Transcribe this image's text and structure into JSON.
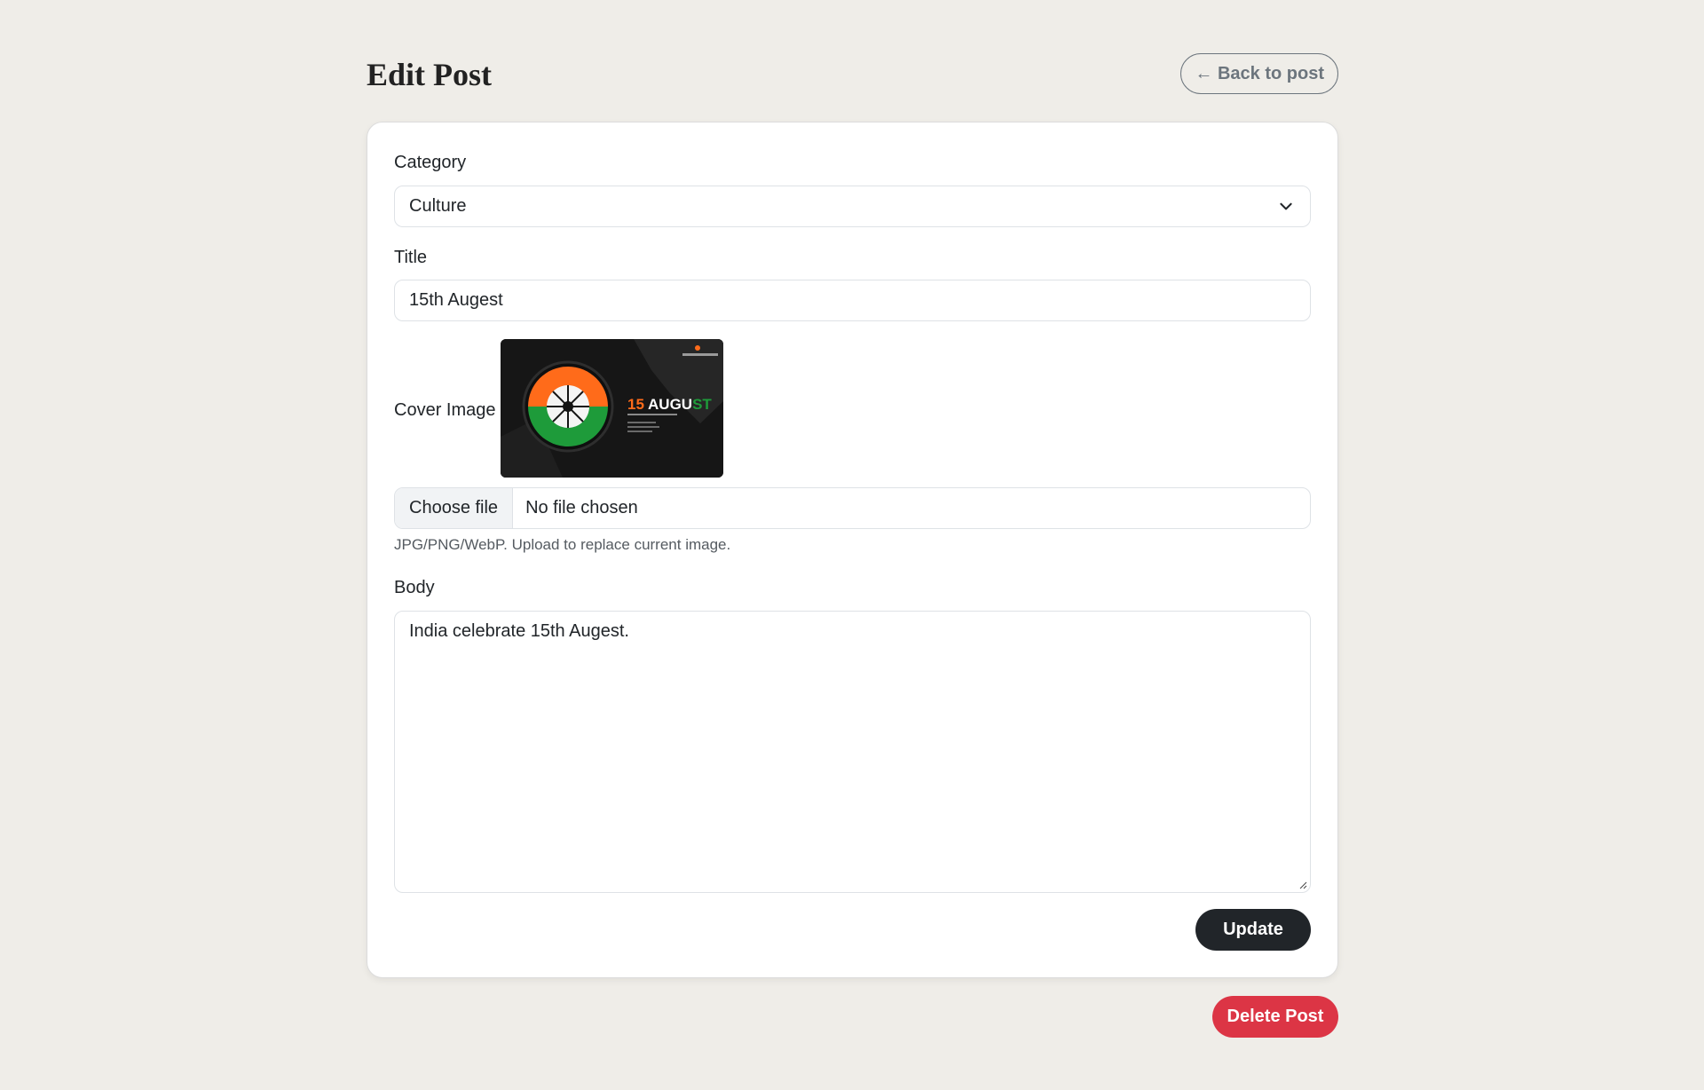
{
  "page": {
    "title": "Edit Post",
    "back_label": "← Back to post"
  },
  "form": {
    "category": {
      "label": "Category",
      "value": "Culture"
    },
    "title": {
      "label": "Title",
      "value": "15th Augest"
    },
    "cover": {
      "label": "Cover Image",
      "thumb_heading": "15 AUGUST",
      "choose_label": "Choose file",
      "file_status": "No file chosen",
      "help": "JPG/PNG/WebP. Upload to replace current image."
    },
    "body": {
      "label": "Body",
      "value": "India celebrate 15th Augest."
    },
    "update_label": "Update"
  },
  "delete_label": "Delete Post",
  "colors": {
    "background": "#efede8",
    "primary_button": "#212529",
    "danger_button": "#dc3545",
    "saffron": "#ff6b1a",
    "green": "#1e9b3a"
  }
}
